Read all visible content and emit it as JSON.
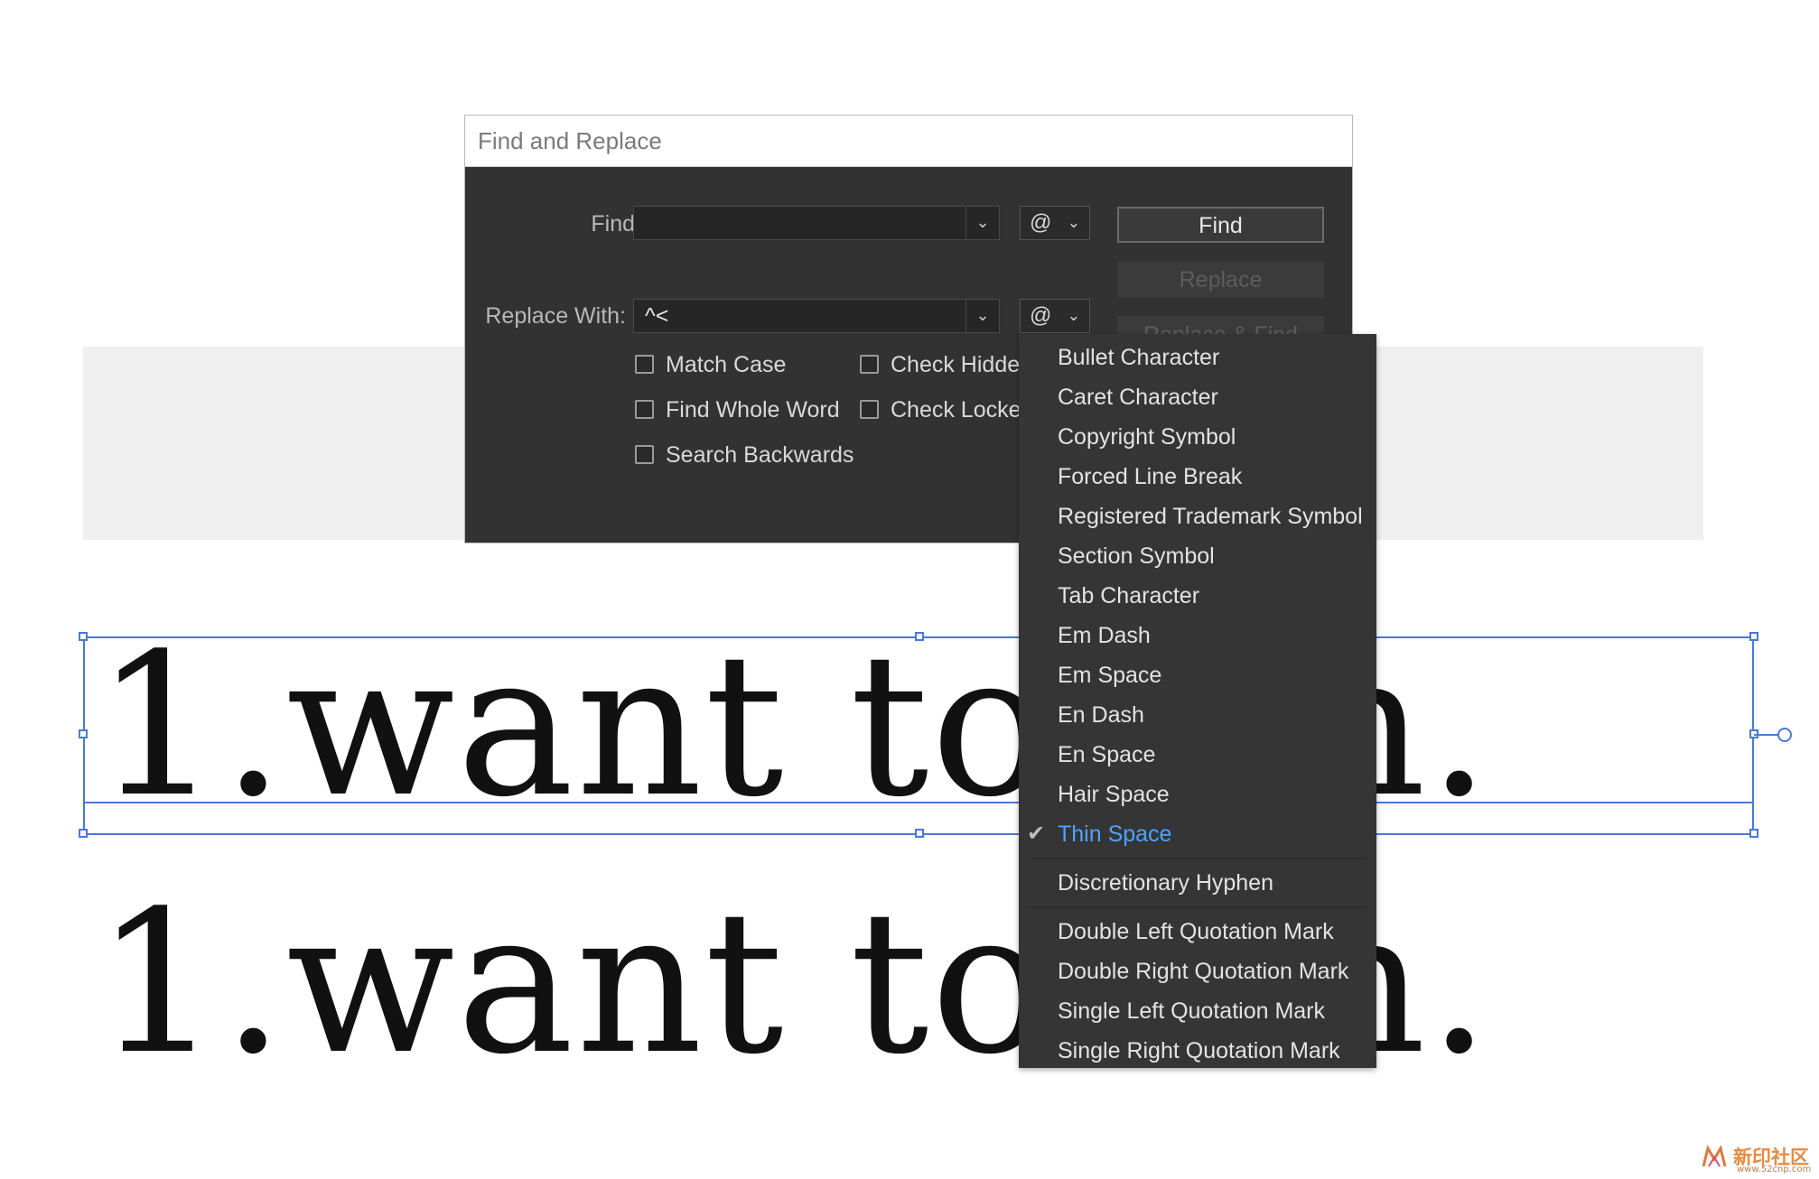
{
  "canvas": {
    "line1": "1.want to sth.",
    "line2": "1.want to sth."
  },
  "dialog": {
    "title": "Find and Replace",
    "find_label": "Find:",
    "find_value": "",
    "replace_label": "Replace With:",
    "replace_value": "^<",
    "special_char_symbol": "@",
    "buttons": {
      "find": "Find",
      "replace": "Replace",
      "replace_and_find": "Replace & Find"
    },
    "options": {
      "match_case": "Match Case",
      "find_whole_word": "Find Whole Word",
      "search_backwards": "Search Backwards",
      "check_hidden": "Check Hidden",
      "check_locked": "Check Locked"
    }
  },
  "special_menu": {
    "items": [
      "Bullet Character",
      "Caret Character",
      "Copyright Symbol",
      "Forced Line Break",
      "Registered Trademark Symbol",
      "Section Symbol",
      "Tab Character",
      "Em Dash",
      "Em Space",
      "En Dash",
      "En Space",
      "Hair Space",
      "Thin Space",
      "Discretionary Hyphen",
      "Double Left Quotation Mark",
      "Double Right Quotation Mark",
      "Single Left Quotation Mark",
      "Single Right Quotation Mark"
    ],
    "checked_item": "Thin Space",
    "check_color": "#4ba4ff"
  },
  "watermark": {
    "text": "新印社区",
    "url": "www.52cnp.com"
  },
  "colors": {
    "dialog_bg": "#323232",
    "selection": "#4a78d6"
  }
}
